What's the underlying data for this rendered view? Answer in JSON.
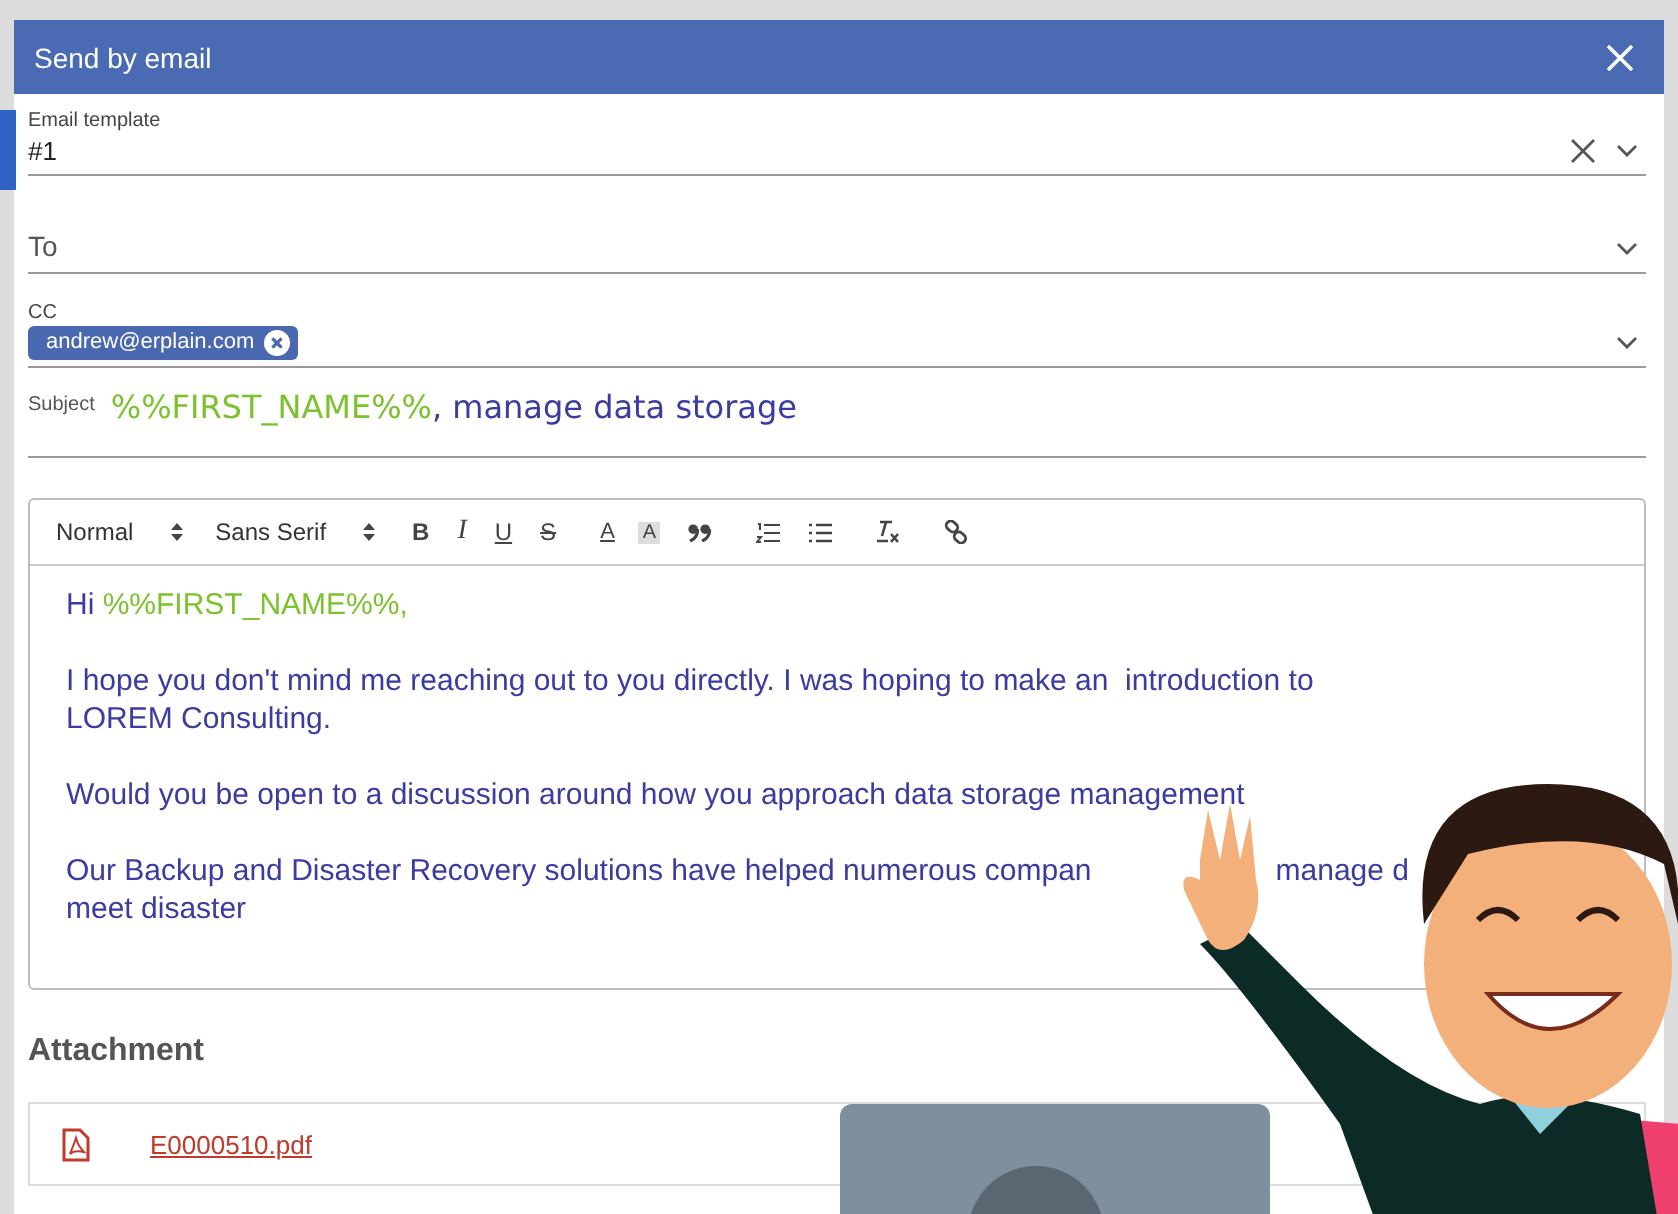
{
  "dialog": {
    "title": "Send by email"
  },
  "fields": [
    {
      "kind": "select",
      "label": "Email template",
      "value": "#1",
      "clearable": true
    },
    {
      "kind": "select",
      "label": "To",
      "clearable": false
    },
    {
      "kind": "chips",
      "label": "CC",
      "chips": [
        "andrew@erplain.com"
      ],
      "clearable": false
    }
  ],
  "subject": {
    "label": "Subject",
    "parts": [
      {
        "kind": "tag",
        "text": "%%FIRST_NAME%%"
      },
      {
        "kind": "text",
        "text": ", manage data storage"
      }
    ]
  },
  "editor": {
    "header_select": "Normal",
    "font_select": "Sans Serif",
    "format_buttons": [
      {
        "kind": "bold",
        "label": "B"
      },
      {
        "kind": "italic",
        "label": "I"
      },
      {
        "kind": "underline",
        "label": "U"
      },
      {
        "kind": "strike",
        "label": "S"
      },
      {
        "kind": "color",
        "label": "A"
      },
      {
        "kind": "background",
        "label": "A"
      }
    ],
    "paragraphs": [
      [
        [
          {
            "kind": "text",
            "text": "Hi "
          },
          {
            "kind": "tag",
            "text": "%%FIRST_NAME%%,"
          }
        ]
      ],
      [
        [
          {
            "kind": "text",
            "text": "I hope you don't mind me reaching out to you directly. I was hoping to make an  introduction to"
          }
        ],
        [
          {
            "kind": "text",
            "text": "LOREM Consulting."
          }
        ]
      ],
      [
        [
          {
            "kind": "text",
            "text": "Would you be open to a discussion around how you approach data storage management"
          }
        ]
      ],
      [
        [
          {
            "kind": "text",
            "text": "Our Backup and Disaster Recovery solutions have helped numerous compan"
          },
          {
            "kind": "after_gap",
            "text": "manage d"
          }
        ],
        [
          {
            "kind": "text",
            "text": "meet disaster"
          }
        ]
      ]
    ]
  },
  "attachment": {
    "title": "Attachment",
    "files": [
      "E0000510.pdf"
    ]
  }
}
